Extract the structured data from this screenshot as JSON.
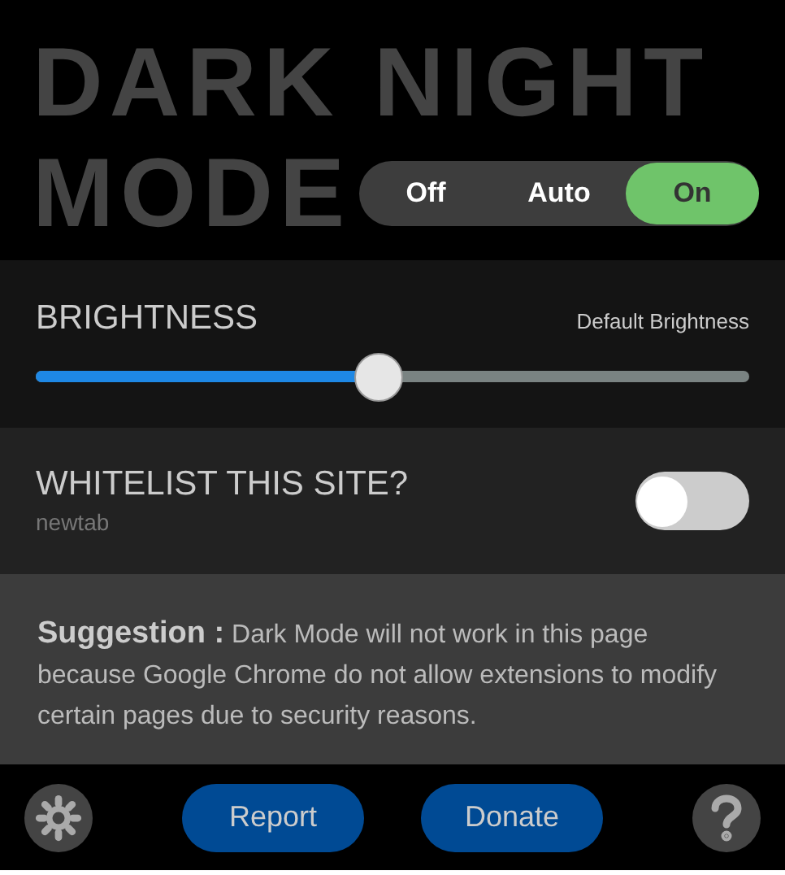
{
  "title_lines": [
    "DARK NIGHT",
    "MODE"
  ],
  "mode_options": [
    {
      "label": "Off",
      "selected": false
    },
    {
      "label": "Auto",
      "selected": false
    },
    {
      "label": "On",
      "selected": true
    }
  ],
  "brightness": {
    "label": "BRIGHTNESS",
    "reset_link": "Default Brightness",
    "level": 0.48
  },
  "whitelist": {
    "label": "WHITELIST THIS SITE?",
    "site": "newtab",
    "on": false
  },
  "suggestion": "**Suggestion :** Dark Mode will not work in this page because Google Chrome do not allow extensions to modify certain pages due to security reasons.",
  "footer_buttons": [
    "Report",
    "Donate"
  ]
}
